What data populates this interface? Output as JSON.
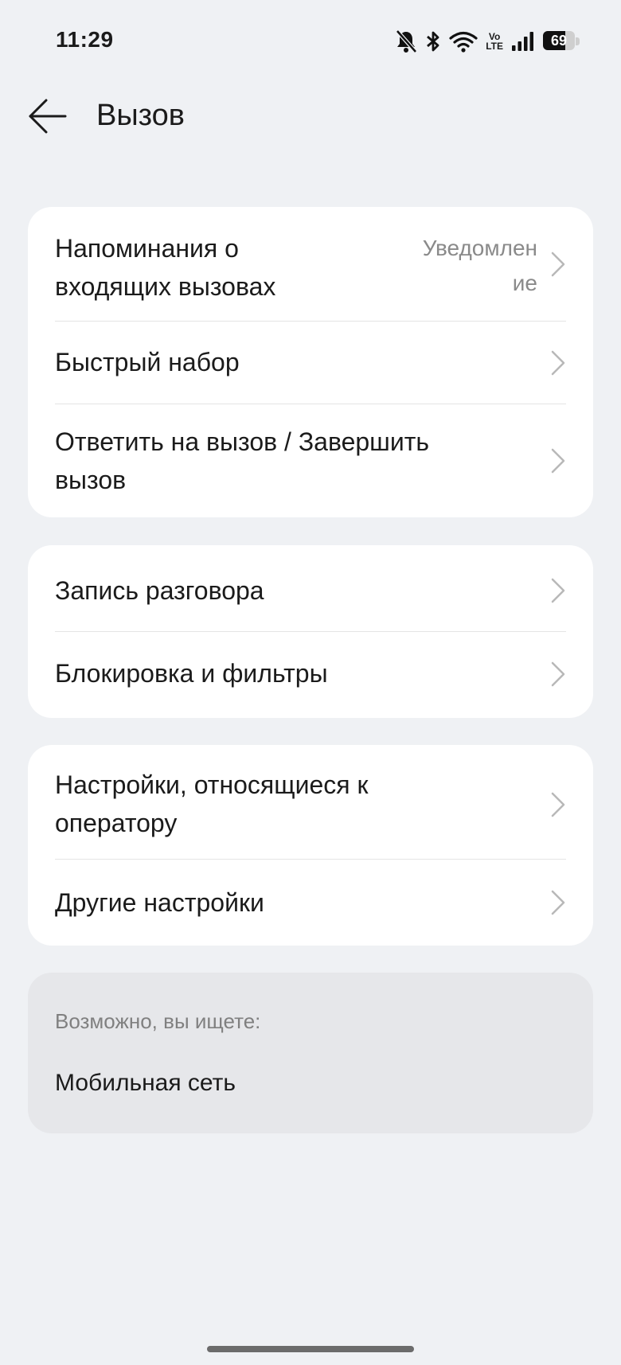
{
  "status_bar": {
    "time": "11:29",
    "volte_top": "Vo",
    "volte_bottom": "LTE",
    "battery_level": "69",
    "battery_fraction": 0.69,
    "icons": [
      "bell-off-icon",
      "bluetooth-icon",
      "wifi-icon",
      "volte-icon",
      "signal-icon",
      "battery-icon"
    ]
  },
  "header": {
    "title": "Вызов",
    "back_icon": "arrow-left-icon"
  },
  "group1": {
    "items": [
      {
        "label_line1": "Напоминания о",
        "label_line2": "входящих вызовах",
        "value_line1": "Уведомлен",
        "value_line2": "ие"
      },
      {
        "label": "Быстрый набор"
      },
      {
        "label_line1": "Ответить на вызов / Завершить",
        "label_line2": "вызов"
      }
    ]
  },
  "group2": {
    "items": [
      {
        "label": "Запись разговора"
      },
      {
        "label": "Блокировка и фильтры"
      }
    ]
  },
  "group3": {
    "items": [
      {
        "label_line1": "Настройки, относящиеся к",
        "label_line2": "оператору"
      },
      {
        "label": "Другие настройки"
      }
    ]
  },
  "suggestions": {
    "title": "Возможно, вы ищете:",
    "items": [
      "Мобильная сеть"
    ]
  },
  "colors": {
    "background": "#eff1f4",
    "card": "#ffffff",
    "suggest_card": "#e6e7ea",
    "text_primary": "#1b1b1b",
    "text_secondary": "#8a8a8a",
    "chevron": "#b8b8b8"
  }
}
